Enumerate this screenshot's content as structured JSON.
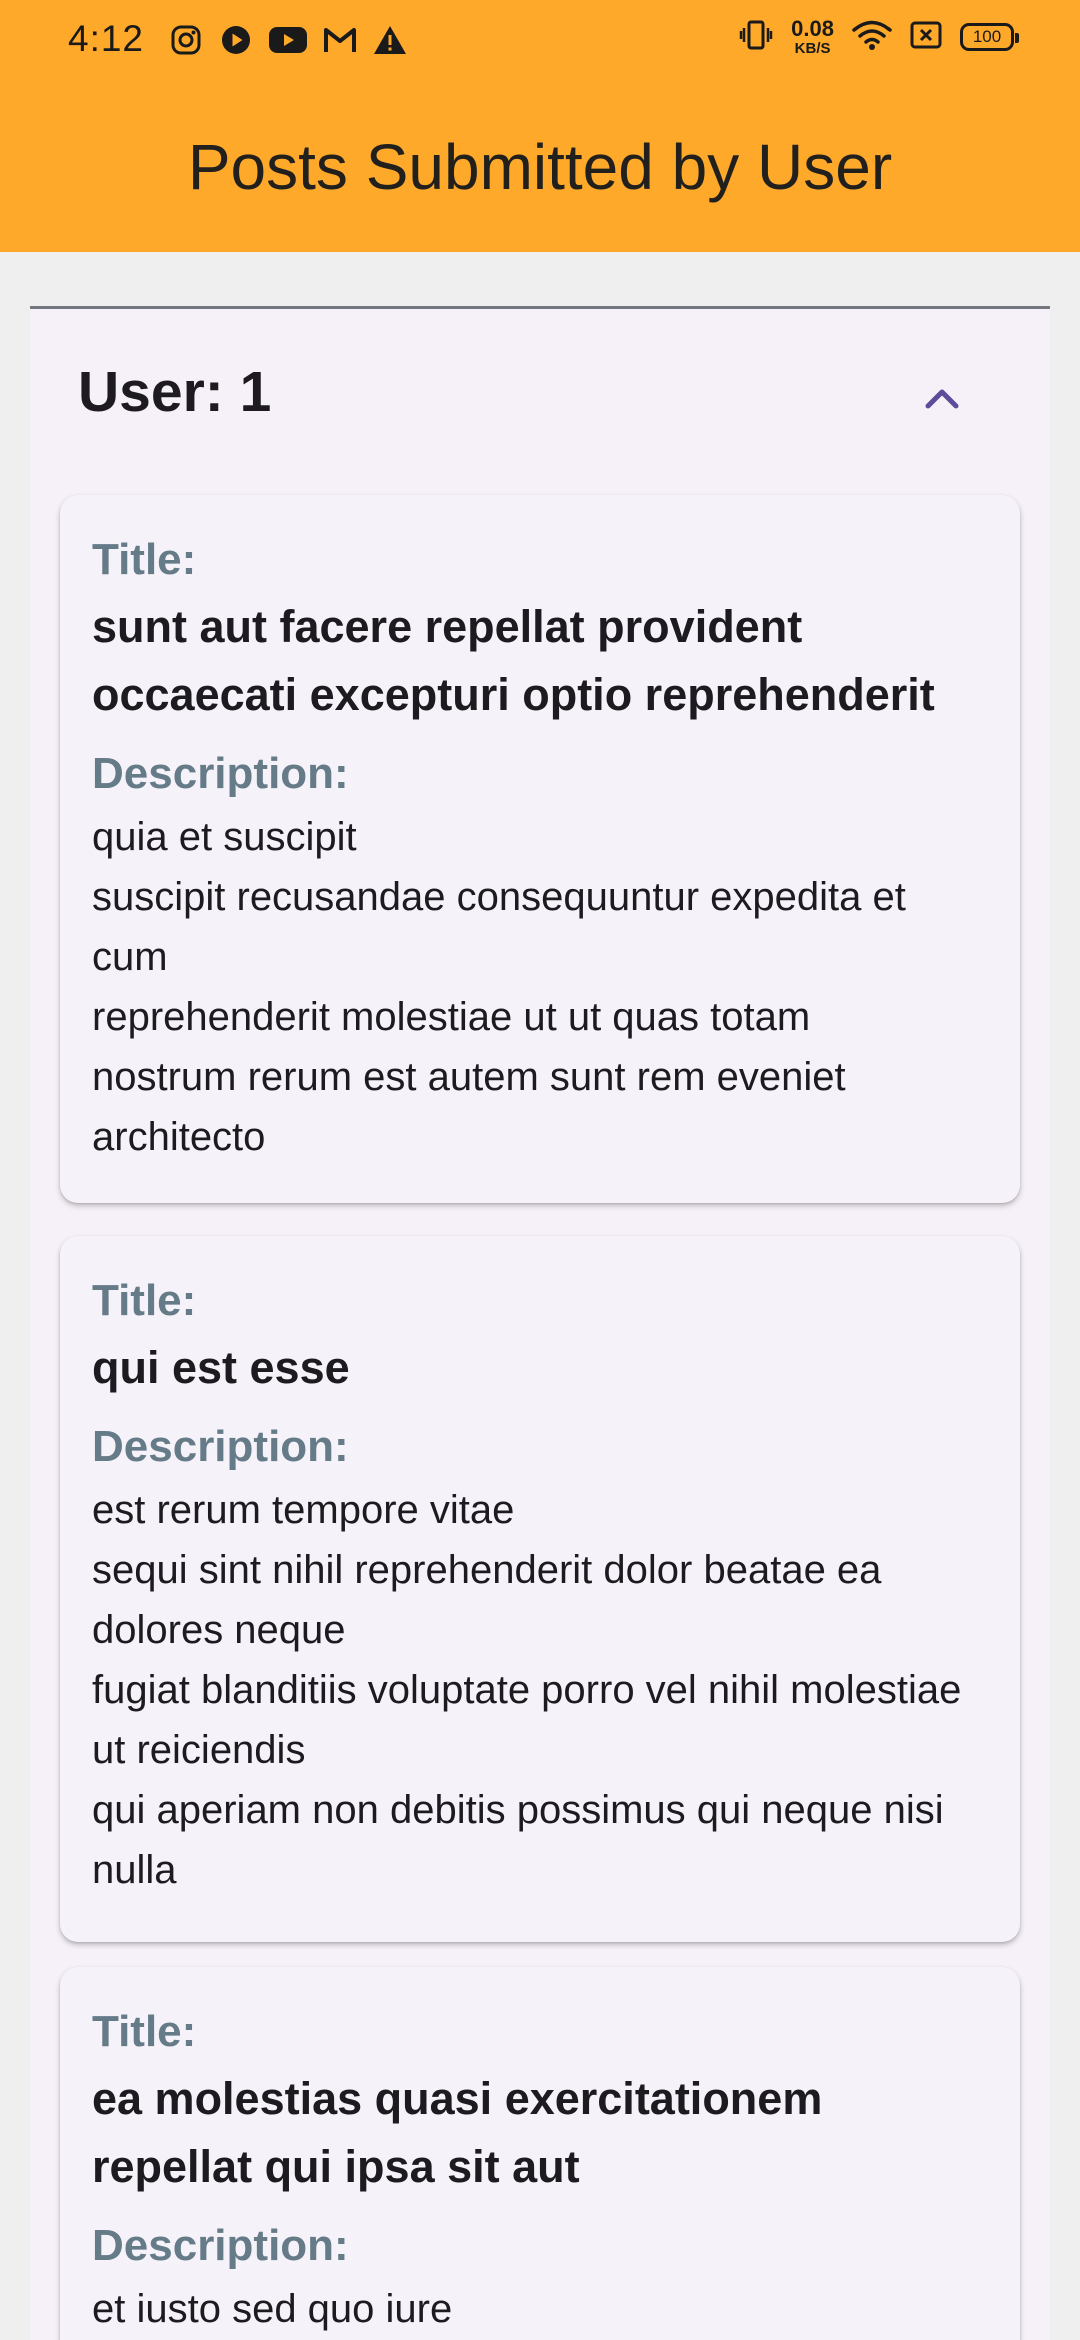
{
  "status_bar": {
    "time": "4:12",
    "net_speed_value": "0.08",
    "net_speed_unit": "KB/S",
    "battery": "100",
    "left_icons": [
      "instagram-icon",
      "play-circle-icon",
      "youtube-icon",
      "gmail-icon",
      "warning-icon"
    ],
    "right_icons": [
      "vibrate-icon",
      "wifi-icon",
      "sim-off-icon",
      "battery-icon"
    ]
  },
  "app_bar": {
    "title": "Posts Submitted by User",
    "background": "#ffa92b"
  },
  "panel": {
    "header": "User: 1",
    "expanded": true,
    "chevron_icon": "chevron-up-icon",
    "accent": "#5b4d9a"
  },
  "posts": [
    {
      "title_label": "Title:",
      "title": "sunt aut facere repellat provident occaecati excepturi optio reprehenderit",
      "description_label": "Description:",
      "description": "quia et suscipit\nsuscipit recusandae consequuntur expedita et cum\nreprehenderit molestiae ut ut quas totam\nnostrum rerum est autem sunt rem eveniet architecto"
    },
    {
      "title_label": "Title:",
      "title": "qui est esse",
      "description_label": "Description:",
      "description": "est rerum tempore vitae\nsequi sint nihil reprehenderit dolor beatae ea dolores neque\nfugiat blanditiis voluptate porro vel nihil molestiae ut reiciendis\nqui aperiam non debitis possimus qui neque nisi nulla"
    },
    {
      "title_label": "Title:",
      "title": "ea molestias quasi exercitationem repellat qui ipsa sit aut",
      "description_label": "Description:",
      "description": "et iusto sed quo iure"
    }
  ]
}
